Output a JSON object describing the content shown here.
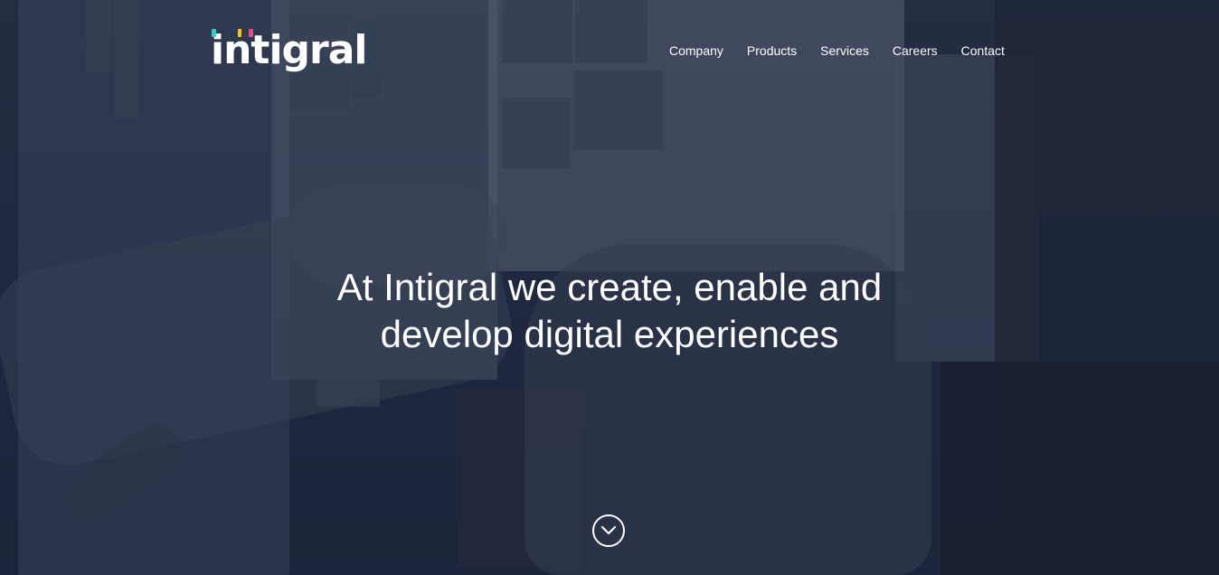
{
  "brand": {
    "logo_text": "intigral",
    "colors": {
      "accent_teal": "#3fc6c6",
      "accent_pink": "#e8478b",
      "accent_yellow": "#f2c230",
      "text": "#ffffff"
    }
  },
  "nav": {
    "items": [
      {
        "label": "Company"
      },
      {
        "label": "Products"
      },
      {
        "label": "Services"
      },
      {
        "label": "Careers"
      },
      {
        "label": "Contact"
      }
    ]
  },
  "hero": {
    "headline_line1": "At Intigral we create, enable and",
    "headline_line2": "develop digital experiences",
    "scroll_icon": "chevron-down-circle-icon"
  }
}
